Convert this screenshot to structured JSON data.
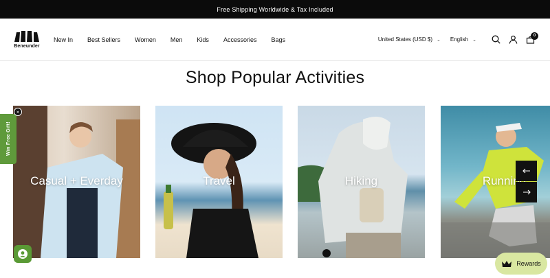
{
  "announcement": "Free Shipping Worldwide & Tax Included",
  "logo": {
    "text": "Beneunder"
  },
  "nav": [
    {
      "label": "New In"
    },
    {
      "label": "Best Sellers"
    },
    {
      "label": "Women"
    },
    {
      "label": "Men"
    },
    {
      "label": "Kids"
    },
    {
      "label": "Accessories"
    },
    {
      "label": "Bags"
    }
  ],
  "header_right": {
    "country": "United States (USD $)",
    "language": "English",
    "icons": [
      "search-icon",
      "account-icon",
      "cart-icon"
    ],
    "cart_count": "0"
  },
  "section_title": "Shop Popular Activities",
  "activities": [
    {
      "label": "Casual + Everday"
    },
    {
      "label": "Travel"
    },
    {
      "label": "Hiking"
    },
    {
      "label": "Running"
    }
  ],
  "side_tab": {
    "label": "Win Free Gift!",
    "close": "×"
  },
  "rewards": {
    "label": "Rewards"
  },
  "colors": {
    "accent_green": "#5f9a3b",
    "rewards_bg": "#d9e7a1",
    "announcement_bg": "#0b0b0b"
  }
}
